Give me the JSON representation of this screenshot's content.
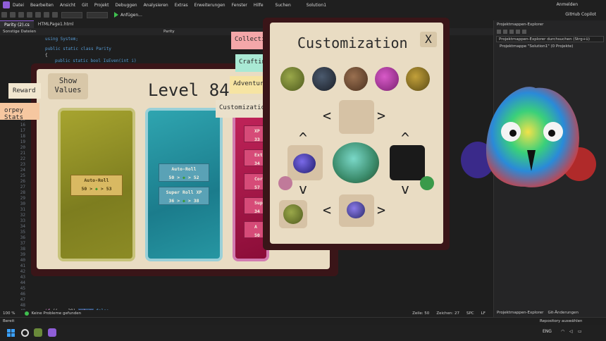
{
  "vs": {
    "menu": [
      "Datei",
      "Bearbeiten",
      "Ansicht",
      "Git",
      "Projekt",
      "Debuggen",
      "Analysieren",
      "Extras",
      "Erweiterungen",
      "Fenster",
      "Hilfe"
    ],
    "search": "Suchen",
    "solution": "Solution1",
    "signin": "Anmelden",
    "copilot": "GitHub Copilot",
    "run_label": "Anfügen...",
    "tabs": [
      "Parity (2).cs",
      "HTMLPage1.html"
    ],
    "sub_left": "Sonstige Dateien",
    "sub_right": "Parity",
    "gutter": [
      "14",
      "15",
      "16",
      "17",
      "18",
      "19",
      "20",
      "21",
      "22",
      "23",
      "24",
      "25",
      "26",
      "27",
      "28",
      "29",
      "30",
      "31",
      "32",
      "33",
      "34",
      "35",
      "36",
      "37",
      "38",
      "39",
      "40",
      "41",
      "42",
      "43",
      "44",
      "45",
      "46",
      "47",
      "48",
      "49",
      "50",
      "51"
    ],
    "code_top": [
      "using System;",
      "public static class Parity",
      "{",
      "public static bool IsEven(int i)"
    ],
    "code_bottom": [
      {
        "n": "39",
        "v": "39"
      },
      {
        "n": "40",
        "v": "40"
      },
      {
        "n": "41",
        "v": "41"
      },
      {
        "n": "42",
        "v": "42"
      },
      {
        "n": "43",
        "v": "43"
      },
      {
        "n": "44",
        "v": "44"
      }
    ],
    "status_problems": "Keine Probleme gefunden",
    "zoom": "100 %",
    "line": "Zeile: 50",
    "char": "Zeichen: 27",
    "spc": "SPC",
    "lf": "LF",
    "ready": "Bereit",
    "repo": "Repository auswählen",
    "lang": "ENG"
  },
  "explorer": {
    "title": "Projektmappen-Explorer",
    "search": "Projektmappen-Explorer durchsuchen (Strg+ü)",
    "item": "Projektmappe \"Solution1\" (0 Projekte)",
    "tab1": "Projektmappen-Explorer",
    "tab2": "Git-Änderungen"
  },
  "game": {
    "level": "Level 84",
    "show_values": [
      "Show",
      "Values"
    ],
    "reward": "Reward",
    "orpey": "orpey Stats",
    "collecting": "Collecting",
    "crafting": "Crafting",
    "adventure": "Adventure",
    "customization_tab": "Customization",
    "autoroll": {
      "name": "Auto-Roll",
      "val": "50 > ",
      "next": "> 53"
    },
    "autoroll2": {
      "name": "Auto-Roll",
      "val": "50 > ",
      "next": "> 52"
    },
    "superroll": {
      "name": "Super Roll XP",
      "val": "36 > ",
      "next": "> 38"
    },
    "pink_cards": [
      {
        "t": "XP",
        "v": "33"
      },
      {
        "t": "Ext",
        "v": "34"
      },
      {
        "t": "Cor",
        "v": "57"
      },
      {
        "t": "Sup",
        "v": "34"
      },
      {
        "t": "A",
        "v": "50"
      }
    ]
  },
  "customization": {
    "title": "Customization",
    "close": "X"
  },
  "colors": {
    "accent": "#8f5ed8",
    "frame": "#3a1518",
    "parchment": "#e9dcc3"
  }
}
